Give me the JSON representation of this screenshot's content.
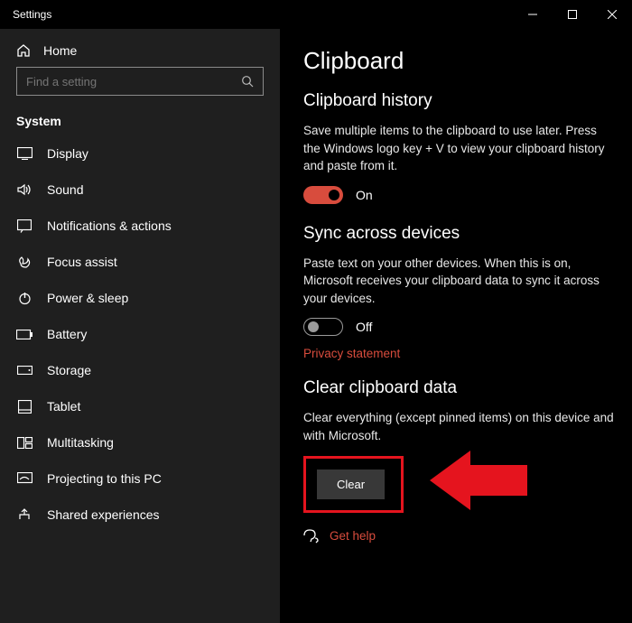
{
  "window": {
    "title": "Settings"
  },
  "sidebar": {
    "home_label": "Home",
    "search_placeholder": "Find a setting",
    "category": "System",
    "items": [
      {
        "label": "Display"
      },
      {
        "label": "Sound"
      },
      {
        "label": "Notifications & actions"
      },
      {
        "label": "Focus assist"
      },
      {
        "label": "Power & sleep"
      },
      {
        "label": "Battery"
      },
      {
        "label": "Storage"
      },
      {
        "label": "Tablet"
      },
      {
        "label": "Multitasking"
      },
      {
        "label": "Projecting to this PC"
      },
      {
        "label": "Shared experiences"
      }
    ]
  },
  "main": {
    "title": "Clipboard",
    "history": {
      "heading": "Clipboard history",
      "desc": "Save multiple items to the clipboard to use later. Press the Windows logo key + V to view your clipboard history and paste from it.",
      "toggle_state": "On"
    },
    "sync": {
      "heading": "Sync across devices",
      "desc": "Paste text on your other devices. When this is on, Microsoft receives your clipboard data to sync it across your devices.",
      "toggle_state": "Off",
      "privacy_link": "Privacy statement"
    },
    "clear": {
      "heading": "Clear clipboard data",
      "desc": "Clear everything (except pinned items) on this device and with Microsoft.",
      "button": "Clear"
    },
    "help_label": "Get help"
  }
}
